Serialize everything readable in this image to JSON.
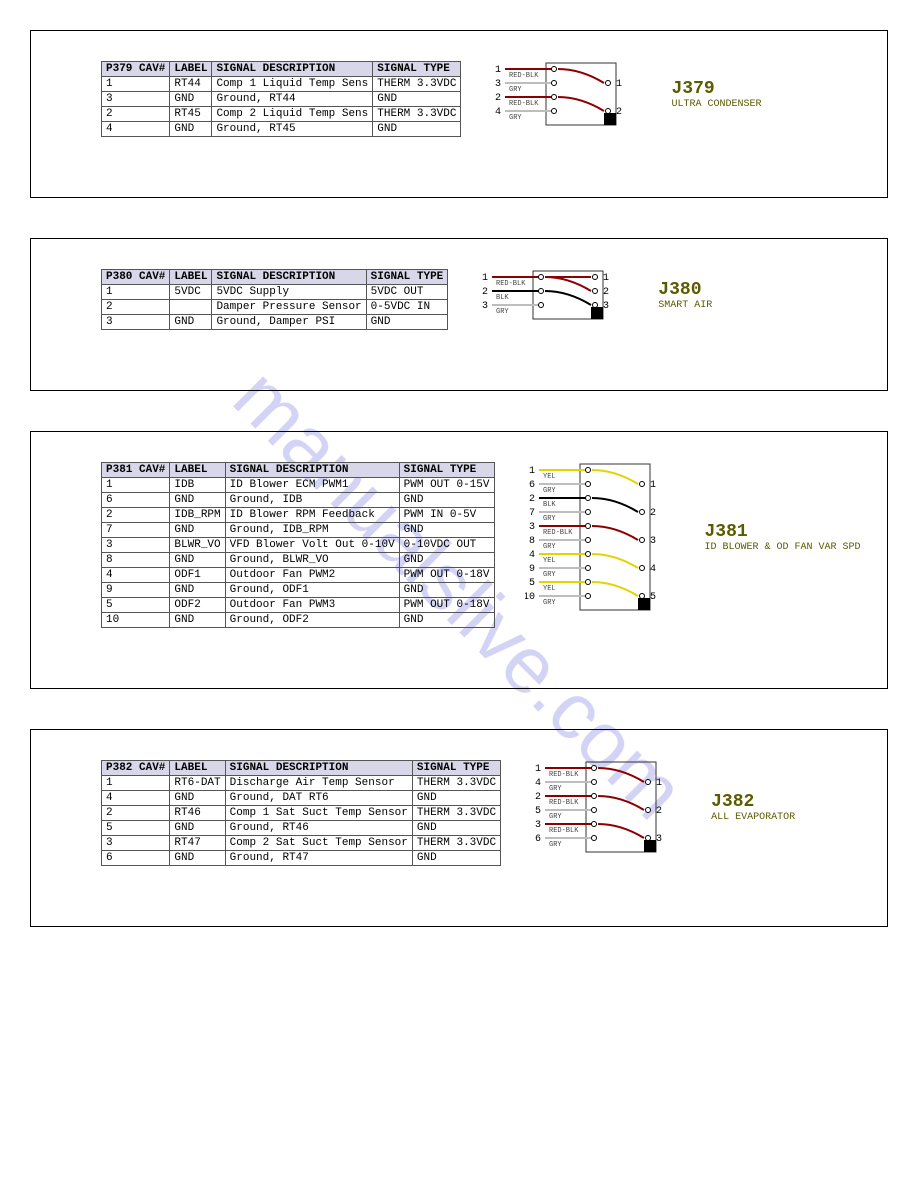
{
  "watermark": "manualslive.com",
  "panels": [
    {
      "id": "J379",
      "desc": "ULTRA CONDENSER",
      "cav_header": "P379 CAV#",
      "headers": [
        "LABEL",
        "SIGNAL DESCRIPTION",
        "SIGNAL TYPE"
      ],
      "rows": [
        [
          "1",
          "RT44",
          "Comp 1 Liquid Temp Sens",
          "THERM 3.3VDC"
        ],
        [
          "3",
          "GND",
          "Ground, RT44",
          "GND"
        ],
        [
          "2",
          "RT45",
          "Comp 2 Liquid Temp Sens",
          "THERM 3.3VDC"
        ],
        [
          "4",
          "GND",
          "Ground, RT45",
          "GND"
        ]
      ],
      "pins": {
        "left": [
          {
            "n": "1",
            "w": "RED-BLK"
          },
          {
            "n": "3",
            "w": "GRY"
          },
          {
            "n": "2",
            "w": "RED-BLK"
          },
          {
            "n": "4",
            "w": "GRY"
          }
        ],
        "right": [
          {
            "n": "1"
          },
          {
            "n": "2"
          }
        ],
        "right_offset": [
          1,
          3
        ],
        "key": "br"
      }
    },
    {
      "id": "J380",
      "desc": "SMART AIR",
      "cav_header": "P380 CAV#",
      "headers": [
        "LABEL",
        "SIGNAL DESCRIPTION",
        "SIGNAL TYPE"
      ],
      "rows": [
        [
          "1",
          "5VDC",
          "5VDC Supply",
          "5VDC OUT"
        ],
        [
          "2",
          "",
          "Damper Pressure Sensor",
          "0-5VDC IN"
        ],
        [
          "3",
          "GND",
          "Ground, Damper PSI",
          "GND"
        ]
      ],
      "pins": {
        "left": [
          {
            "n": "1",
            "w": "RED-BLK"
          },
          {
            "n": "2",
            "w": "BLK"
          },
          {
            "n": "3",
            "w": "GRY"
          }
        ],
        "right": [
          {
            "n": "1"
          },
          {
            "n": "2"
          },
          {
            "n": "3"
          }
        ],
        "right_offset": [
          0,
          1,
          2
        ],
        "key": "br-pair"
      }
    },
    {
      "id": "J381",
      "desc": "ID BLOWER & OD FAN VAR SPD",
      "cav_header": "P381 CAV#",
      "headers": [
        "LABEL",
        "SIGNAL DESCRIPTION",
        "SIGNAL TYPE"
      ],
      "rows": [
        [
          "1",
          "IDB",
          "ID Blower ECM PWM1",
          "PWM OUT 0-15V"
        ],
        [
          "6",
          "GND",
          "Ground, IDB",
          "GND"
        ],
        [
          "2",
          "IDB_RPM",
          "ID Blower RPM Feedback",
          "PWM IN 0-5V"
        ],
        [
          "7",
          "GND",
          "Ground, IDB_RPM",
          "GND"
        ],
        [
          "3",
          "BLWR_VO",
          "VFD Blower Volt Out 0-10V",
          "0-10VDC OUT"
        ],
        [
          "8",
          "GND",
          "Ground, BLWR_VO",
          "GND"
        ],
        [
          "4",
          "ODF1",
          "Outdoor Fan PWM2",
          "PWM OUT 0-18V"
        ],
        [
          "9",
          "GND",
          "Ground, ODF1",
          "GND"
        ],
        [
          "5",
          "ODF2",
          "Outdoor Fan PWM3",
          "PWM OUT 0-18V"
        ],
        [
          "10",
          "GND",
          "Ground, ODF2",
          "GND"
        ]
      ],
      "pins": {
        "left": [
          {
            "n": "1",
            "w": "YEL"
          },
          {
            "n": "6",
            "w": "GRY"
          },
          {
            "n": "2",
            "w": "BLK"
          },
          {
            "n": "7",
            "w": "GRY"
          },
          {
            "n": "3",
            "w": "RED-BLK"
          },
          {
            "n": "8",
            "w": "GRY"
          },
          {
            "n": "4",
            "w": "YEL"
          },
          {
            "n": "9",
            "w": "GRY"
          },
          {
            "n": "5",
            "w": "YEL"
          },
          {
            "n": "10",
            "w": "GRY"
          }
        ],
        "right": [
          {
            "n": "1"
          },
          {
            "n": "2"
          },
          {
            "n": "3"
          },
          {
            "n": "4"
          },
          {
            "n": "5"
          }
        ],
        "right_offset": [
          1,
          3,
          5,
          7,
          9
        ],
        "key": "br"
      }
    },
    {
      "id": "J382",
      "desc": "ALL EVAPORATOR",
      "cav_header": "P382 CAV#",
      "headers": [
        "LABEL",
        "SIGNAL DESCRIPTION",
        "SIGNAL TYPE"
      ],
      "rows": [
        [
          "1",
          "RT6-DAT",
          "Discharge Air Temp Sensor",
          "THERM 3.3VDC"
        ],
        [
          "4",
          "GND",
          "Ground, DAT RT6",
          "GND"
        ],
        [
          "2",
          "RT46",
          "Comp 1 Sat Suct Temp Sensor",
          "THERM 3.3VDC"
        ],
        [
          "5",
          "GND",
          "Ground, RT46",
          "GND"
        ],
        [
          "3",
          "RT47",
          "Comp 2 Sat Suct Temp Sensor",
          "THERM 3.3VDC"
        ],
        [
          "6",
          "GND",
          "Ground, RT47",
          "GND"
        ]
      ],
      "pins": {
        "left": [
          {
            "n": "1",
            "w": "RED-BLK"
          },
          {
            "n": "4",
            "w": "GRY"
          },
          {
            "n": "2",
            "w": "RED-BLK"
          },
          {
            "n": "5",
            "w": "GRY"
          },
          {
            "n": "3",
            "w": "RED-BLK"
          },
          {
            "n": "6",
            "w": "GRY"
          }
        ],
        "right": [
          {
            "n": "1"
          },
          {
            "n": "2"
          },
          {
            "n": "3"
          }
        ],
        "right_offset": [
          1,
          3,
          5
        ],
        "key": "br"
      }
    }
  ],
  "wire_colors": {
    "RED-BLK": "#8b0000",
    "GRY": "#bdbdbd",
    "BLK": "#000000",
    "YEL": "#e6d200"
  }
}
